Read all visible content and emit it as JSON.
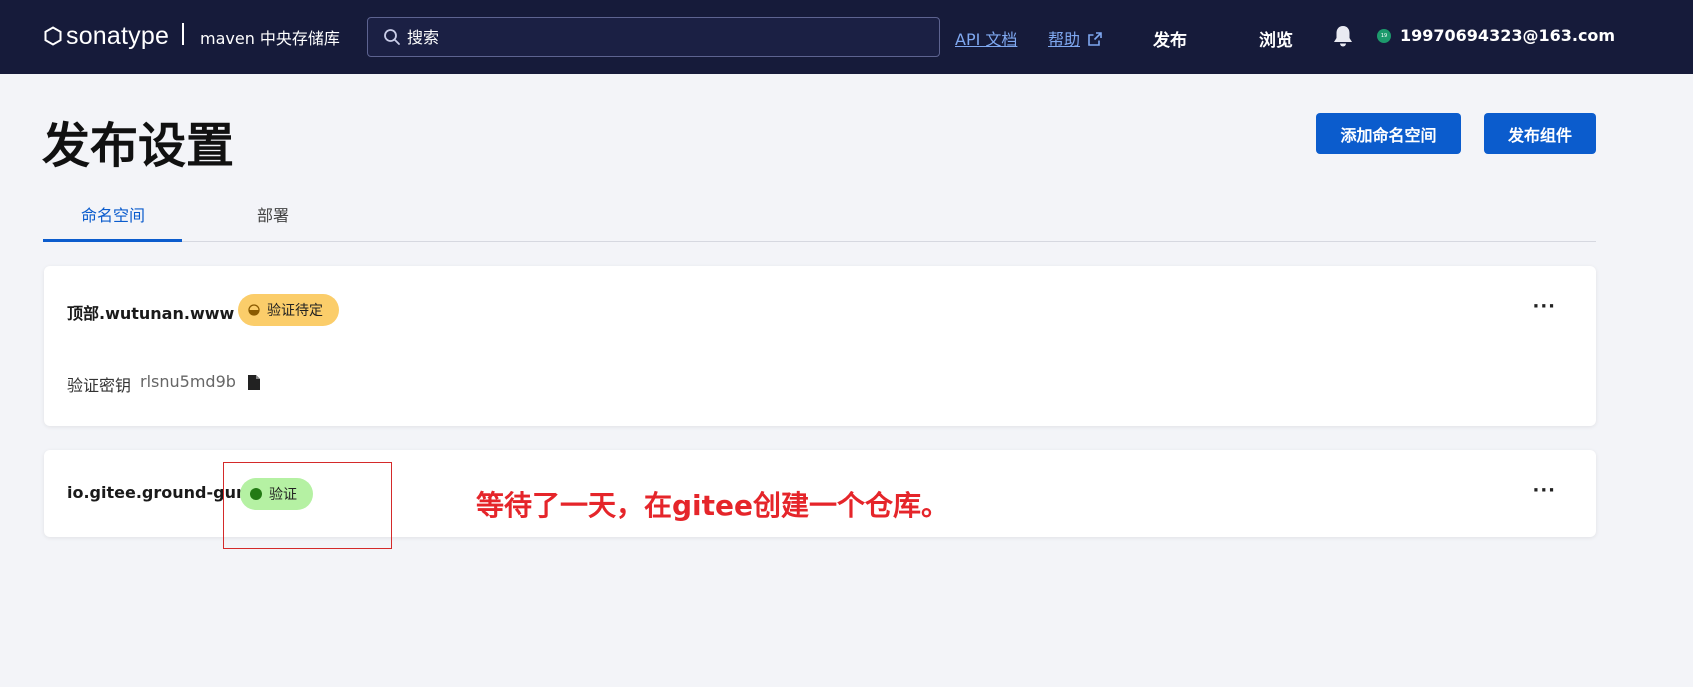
{
  "header": {
    "logo_text": "sonatype",
    "repo_name": "maven 中央存储库",
    "search_placeholder": "搜索",
    "api_docs": "API 文档",
    "help": "帮助",
    "publish": "发布",
    "browse": "浏览",
    "avatar_initials": "19",
    "user_email": "19970694323@163.com"
  },
  "page": {
    "title": "发布设置",
    "add_namespace_button": "添加命名空间",
    "publish_component_button": "发布组件"
  },
  "tabs": [
    {
      "label": "命名空间",
      "active": true
    },
    {
      "label": "部署",
      "active": false
    }
  ],
  "namespaces": [
    {
      "name": "顶部.wutunan.www",
      "status": "验证待定",
      "status_color": "#fbcd6a",
      "verification_key_label": "验证密钥",
      "verification_key": "rlsnu5md9b",
      "more": "···"
    },
    {
      "name": "io.gitee.ground-gun",
      "status": "验证",
      "status_color": "#b5f1a3",
      "more": "···"
    }
  ],
  "annotation": {
    "text": "等待了一天，在gitee创建一个仓库。",
    "color": "#e5252a"
  },
  "colors": {
    "topbar": "#161b3a",
    "accent": "#0b5ccd",
    "background": "#f3f4f8"
  }
}
